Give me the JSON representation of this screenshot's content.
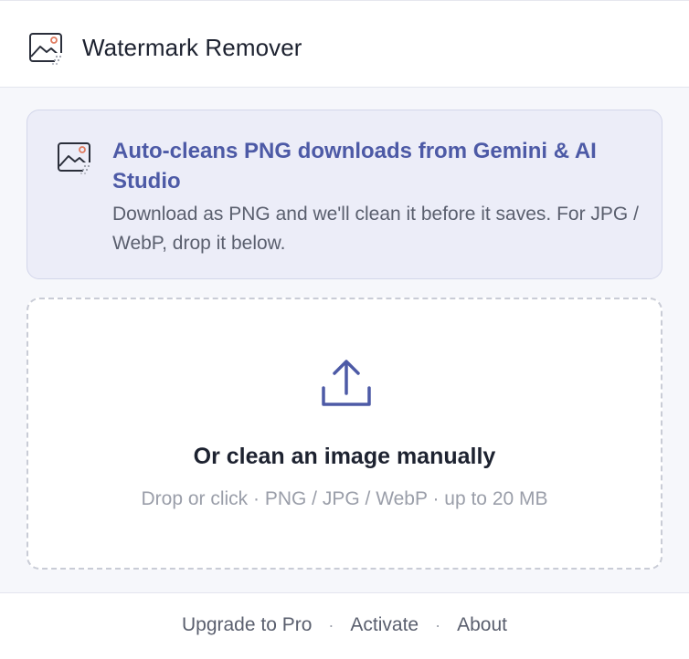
{
  "header": {
    "title": "Watermark Remover",
    "logo_icon": "image-sparkle-icon"
  },
  "info_card": {
    "icon": "image-sparkle-icon",
    "title": "Auto-cleans PNG downloads from Gemini & AI Studio",
    "description": "Download as PNG and we'll clean it before it saves. For JPG / WebP, drop it below."
  },
  "dropzone": {
    "icon": "upload-icon",
    "title": "Or clean an image manually",
    "subtitle": "Drop or click · PNG / JPG / WebP · up to 20 MB"
  },
  "footer": {
    "links": [
      "Upgrade to Pro",
      "Activate",
      "About"
    ],
    "separator": "·"
  },
  "colors": {
    "accent": "#4d5aa6",
    "card_bg": "#ecedf8",
    "page_bg": "#f6f7fb",
    "icon_accent": "#e07b5f"
  }
}
